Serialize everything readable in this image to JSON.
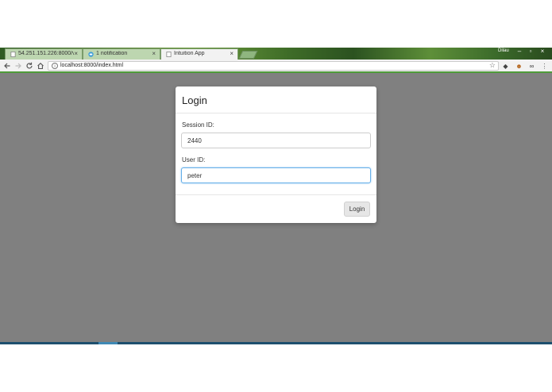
{
  "browser": {
    "tabs": [
      {
        "label": "54.251.151.226:8000/vis",
        "active": false
      },
      {
        "label": "1 notification",
        "active": false
      },
      {
        "label": "Intuition App",
        "active": true
      }
    ],
    "tab_close": "×",
    "profile_name": "Dilau",
    "window_controls": {
      "minimize": "–",
      "maximize": "▫",
      "close": "×"
    },
    "url": "localhost:8000/index.html",
    "accent_color": "#4f9b3a"
  },
  "modal": {
    "title": "Login",
    "session_label": "Session ID:",
    "session_value": "2440",
    "user_label": "User ID:",
    "user_value": "peter",
    "login_button": "Login"
  }
}
